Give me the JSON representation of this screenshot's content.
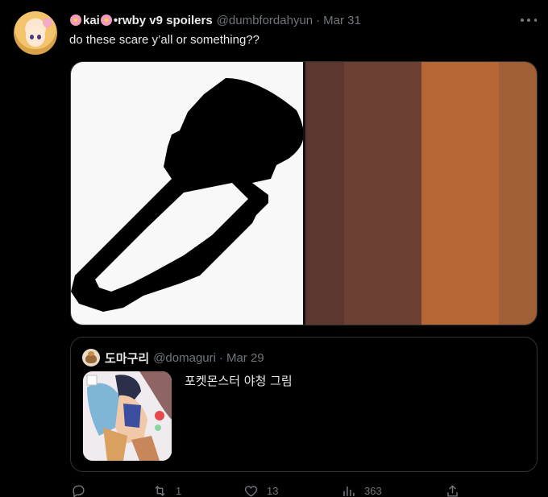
{
  "tweet": {
    "display_name": "kai",
    "display_name_suffix": "•rwby v9 spoilers",
    "handle": "@dumbfordahyun",
    "separator": "·",
    "timestamp": "Mar 31",
    "text": "do these scare y’all or something??"
  },
  "media": {
    "swatches": [
      {
        "color": "#5b372f",
        "width": 48
      },
      {
        "color": "#6c3f33",
        "width": 97
      },
      {
        "color": "#b56634",
        "width": 97
      },
      {
        "color": "#a05f36",
        "width": 47
      }
    ]
  },
  "quote": {
    "name": "도마구리",
    "handle": "@domaguri",
    "separator": "·",
    "timestamp": "Mar 29",
    "text": "포켓몬스터 야청 그림"
  },
  "actions": {
    "reply_count": "",
    "retweet_count": "1",
    "like_count": "13",
    "views_count": "363"
  },
  "icons": [
    "flower-icon",
    "more-icon",
    "eyedropper-icon",
    "reply-icon",
    "retweet-icon",
    "like-icon",
    "views-icon",
    "share-icon"
  ]
}
